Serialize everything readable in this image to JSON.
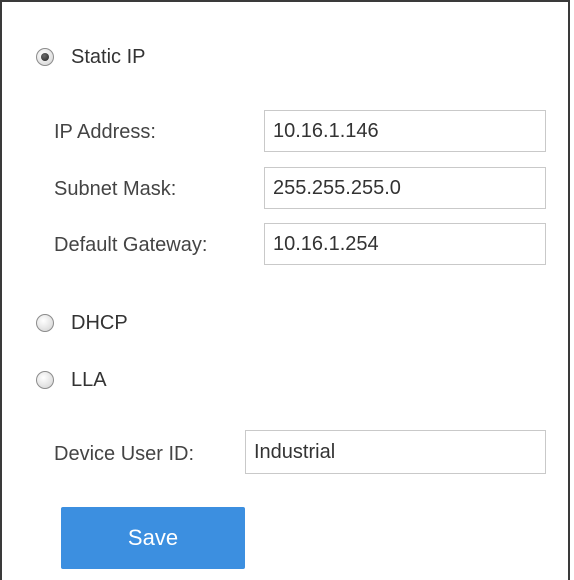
{
  "network": {
    "static_ip": {
      "label": "Static IP",
      "selected": true,
      "fields": [
        {
          "label": "IP Address:",
          "value": "10.16.1.146"
        },
        {
          "label": "Subnet Mask:",
          "value": "255.255.255.0"
        },
        {
          "label": "Default Gateway:",
          "value": "10.16.1.254"
        }
      ]
    },
    "dhcp": {
      "label": "DHCP",
      "selected": false
    },
    "lla": {
      "label": "LLA",
      "selected": false
    }
  },
  "device": {
    "user_id_label": "Device User ID:",
    "user_id_value": "Industrial"
  },
  "actions": {
    "save_label": "Save",
    "save_color": "#3c8fe0"
  }
}
